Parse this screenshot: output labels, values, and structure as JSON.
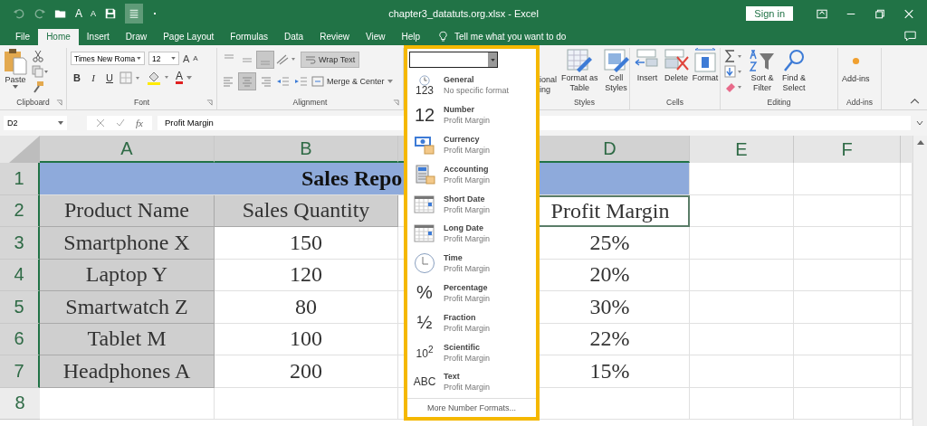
{
  "title_bar": {
    "quick_access": {
      "grow_font": "A",
      "shrink_font": "A"
    },
    "title": "chapter3_datatuts.org.xlsx - Excel",
    "sign_in": "Sign in"
  },
  "tabs": [
    {
      "label": "File",
      "selected": false
    },
    {
      "label": "Home",
      "selected": true
    },
    {
      "label": "Insert",
      "selected": false
    },
    {
      "label": "Draw",
      "selected": false
    },
    {
      "label": "Page Layout",
      "selected": false
    },
    {
      "label": "Formulas",
      "selected": false
    },
    {
      "label": "Data",
      "selected": false
    },
    {
      "label": "Review",
      "selected": false
    },
    {
      "label": "View",
      "selected": false
    },
    {
      "label": "Help",
      "selected": false
    }
  ],
  "tell_me": "Tell me what you want to do",
  "ribbon": {
    "clipboard": {
      "paste": "Paste",
      "label": "Clipboard"
    },
    "font": {
      "font_name": "Times New Roma",
      "font_size": "12",
      "grow": "A",
      "shrink": "A",
      "bold": "B",
      "italic": "I",
      "underline": "U",
      "font_color": "A",
      "label": "Font"
    },
    "alignment": {
      "vertical": [
        {
          "selected": false
        },
        {
          "selected": false
        },
        {
          "selected": true
        }
      ],
      "horizontal": [
        {
          "selected": false
        },
        {
          "selected": true
        },
        {
          "selected": false
        }
      ],
      "wrap_text": {
        "label": "Wrap Text",
        "on": true
      },
      "merge_center": "Merge & Center",
      "label": "Alignment"
    },
    "styles": {
      "conditional_formatting": [
        "ional",
        "ing"
      ],
      "format_as_table": [
        "Format as",
        "Table"
      ],
      "cell_styles": [
        "Cell",
        "Styles"
      ],
      "label": "Styles"
    },
    "cells": {
      "insert": "Insert",
      "delete": "Delete",
      "format": "Format",
      "label": "Cells"
    },
    "editing": {
      "sort_filter": [
        "Sort &",
        "Filter"
      ],
      "find_select": [
        "Find &",
        "Select"
      ],
      "label": "Editing"
    },
    "add_ins": {
      "add_ins": "Add-ins",
      "label": "Add-ins"
    }
  },
  "formula_bar": {
    "name_box": "D2",
    "fx": "fx",
    "content": "Profit Margin"
  },
  "sheet": {
    "columns": [
      {
        "label": "A",
        "selected": true
      },
      {
        "label": "B",
        "selected": true
      },
      {
        "selected": true
      },
      {
        "label": "D",
        "selected": true
      },
      {
        "label": "E",
        "selected": false
      },
      {
        "label": "F",
        "selected": false
      }
    ],
    "rows": [
      {
        "number": "1",
        "selected": true,
        "kind": "title",
        "title": "Sales Repo"
      },
      {
        "number": "2",
        "selected": true,
        "kind": "header",
        "cells": [
          {
            "text": "Product Name",
            "active": false
          },
          {
            "text": "Sales Quantity",
            "active": false
          },
          {
            "text": "Profit Margin",
            "active": true
          }
        ]
      },
      {
        "number": "3",
        "selected": true,
        "kind": "data",
        "cells": [
          {
            "text": "Smartphone X",
            "active": false
          },
          {
            "text": "150",
            "active": false
          },
          {
            "text": "25%",
            "active": false
          }
        ]
      },
      {
        "number": "4",
        "selected": true,
        "kind": "data",
        "cells": [
          {
            "text": "Laptop Y",
            "active": false
          },
          {
            "text": "120",
            "active": false
          },
          {
            "text": "20%",
            "active": false
          }
        ]
      },
      {
        "number": "5",
        "selected": true,
        "kind": "data",
        "cells": [
          {
            "text": "Smartwatch Z",
            "active": false
          },
          {
            "text": "80",
            "active": false
          },
          {
            "text": "30%",
            "active": false
          }
        ]
      },
      {
        "number": "6",
        "selected": true,
        "kind": "data",
        "cells": [
          {
            "text": "Tablet M",
            "active": false
          },
          {
            "text": "100",
            "active": false
          },
          {
            "text": "22%",
            "active": false
          }
        ]
      },
      {
        "number": "7",
        "selected": true,
        "kind": "data",
        "cells": [
          {
            "text": "Headphones A",
            "active": false
          },
          {
            "text": "200",
            "active": false
          },
          {
            "text": "15%",
            "active": false
          }
        ]
      },
      {
        "number": "8",
        "selected": false,
        "kind": "empty"
      }
    ]
  },
  "number_format_menu": {
    "items": [
      {
        "kind": "clock-glyph",
        "glyph": "123",
        "title": "General",
        "subtitle": "No specific format"
      },
      {
        "kind": "glyph",
        "glyph": "12",
        "title": "Number",
        "subtitle": "Profit Margin"
      },
      {
        "kind": "currency",
        "title": "Currency",
        "subtitle": "Profit Margin"
      },
      {
        "kind": "accounting",
        "title": "Accounting",
        "subtitle": "Profit Margin"
      },
      {
        "kind": "calendar",
        "title": "Short Date",
        "subtitle": "Profit Margin"
      },
      {
        "kind": "calendar",
        "title": "Long Date",
        "subtitle": "Profit Margin"
      },
      {
        "kind": "clock",
        "title": "Time",
        "subtitle": "Profit Margin"
      },
      {
        "kind": "glyph",
        "glyph": "%",
        "title": "Percentage",
        "subtitle": "Profit Margin"
      },
      {
        "kind": "glyph",
        "glyph": "½",
        "title": "Fraction",
        "subtitle": "Profit Margin"
      },
      {
        "kind": "glyph",
        "glyph": "10$^{2}$",
        "title": "Scientific",
        "subtitle": "Profit Margin"
      },
      {
        "kind": "glyph",
        "glyph": "ABC",
        "title": "Text",
        "subtitle": "Profit Margin"
      }
    ],
    "more": "More Number Formats..."
  }
}
